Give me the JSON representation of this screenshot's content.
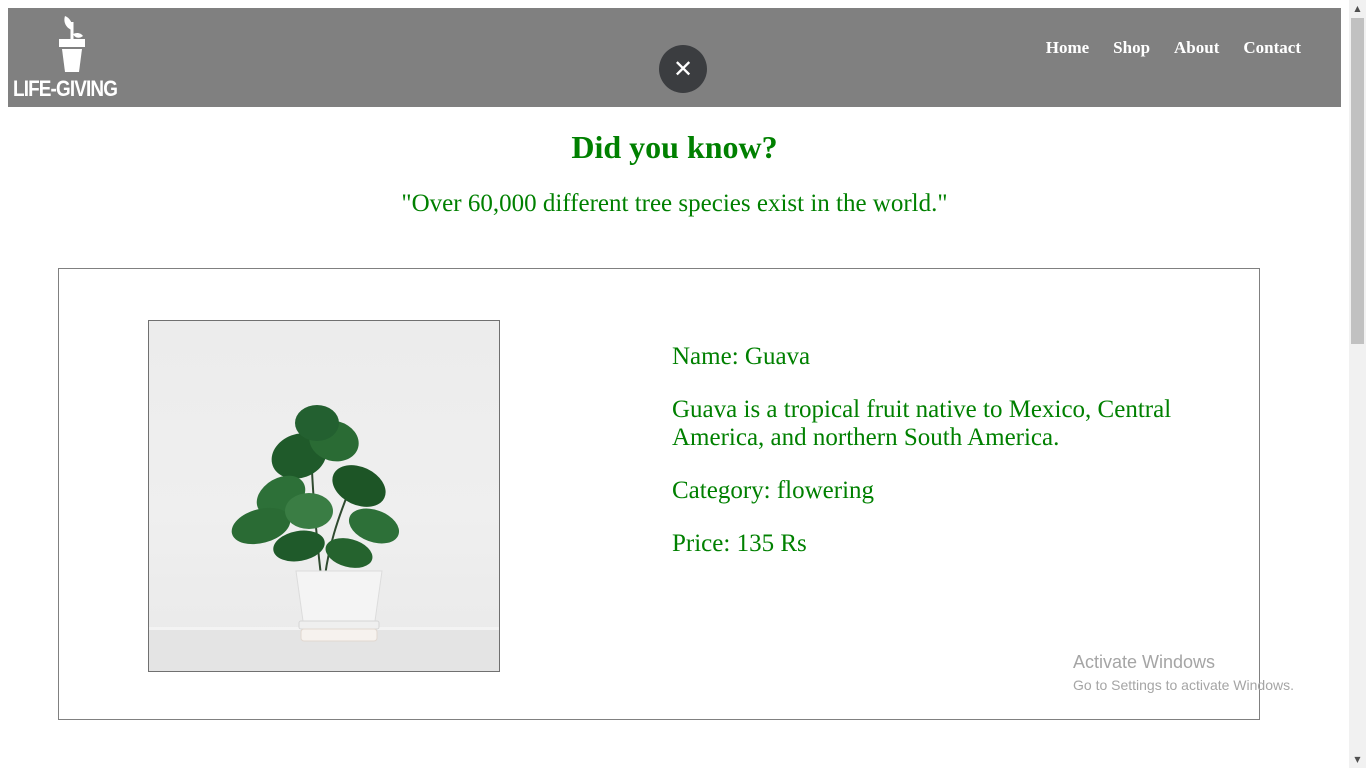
{
  "header": {
    "logo_text": "LIFE-GIVING",
    "close_symbol": "✕",
    "nav": {
      "home": "Home",
      "shop": "Shop",
      "about": "About",
      "contact": "Contact"
    }
  },
  "fact": {
    "title": "Did you know?",
    "text": "\"Over 60,000 different tree species exist in the world.\""
  },
  "product": {
    "name": "Name: Guava",
    "description": "Guava is a tropical fruit native to Mexico, Central America, and northern South America.",
    "category": "Category: flowering",
    "price": "Price: 135 Rs",
    "image_icon": "potted-plant-image"
  },
  "watermark": {
    "title": "Activate Windows",
    "subtitle": "Go to Settings to activate Windows."
  },
  "scrollbar": {
    "up_arrow": "▲",
    "down_arrow": "▼"
  },
  "colors": {
    "header_bg": "#808080",
    "accent_green": "#008000",
    "close_btn_bg": "#3b3d40"
  }
}
